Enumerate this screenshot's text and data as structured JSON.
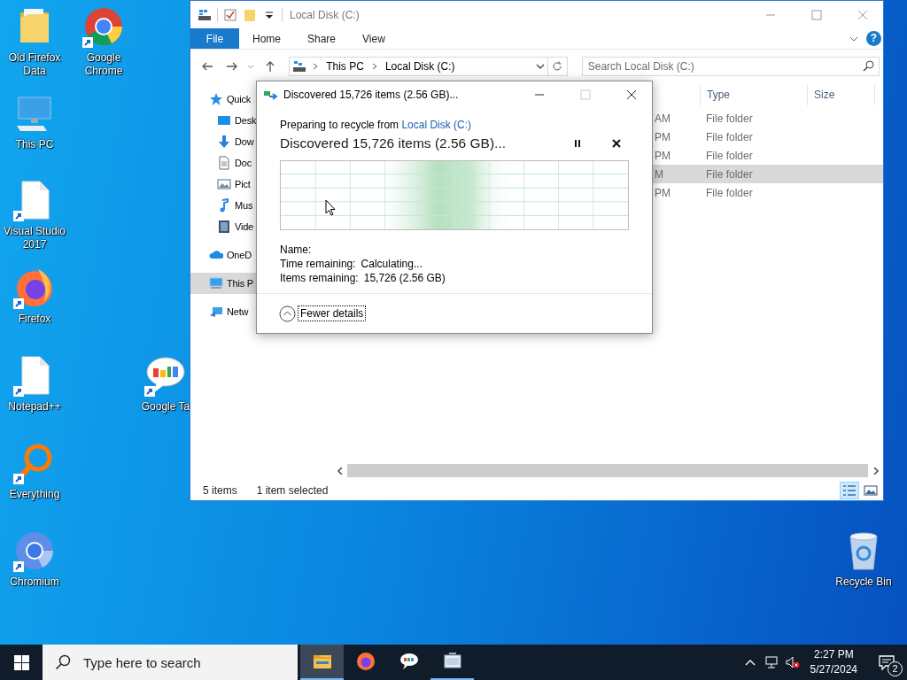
{
  "desktop_icons": [
    {
      "label": "Old Firefox Data",
      "kind": "folder",
      "shortcut": false
    },
    {
      "label": "Google Chrome",
      "kind": "chrome",
      "shortcut": true
    },
    {
      "label": "This PC",
      "kind": "pc",
      "shortcut": false
    },
    {
      "label": "Visual Studio 2017",
      "kind": "file",
      "shortcut": true
    },
    {
      "label": "Firefox",
      "kind": "firefox",
      "shortcut": true
    },
    {
      "label": "Notepad++",
      "kind": "file",
      "shortcut": true
    },
    {
      "label": "Google Ta",
      "kind": "talk",
      "shortcut": true
    },
    {
      "label": "Everything",
      "kind": "everything",
      "shortcut": true
    },
    {
      "label": "Chromium",
      "kind": "chromium",
      "shortcut": true
    },
    {
      "label": "Recycle Bin",
      "kind": "recycle",
      "shortcut": false
    }
  ],
  "explorer": {
    "title": "Local Disk (C:)",
    "file_tab": "File",
    "ribbon_tabs": [
      "Home",
      "Share",
      "View"
    ],
    "help": "?",
    "breadcrumb": [
      "This PC",
      "Local Disk (C:)"
    ],
    "search": {
      "placeholder": "Search Local Disk (C:)"
    },
    "nav_items": [
      {
        "label": "Quick",
        "kind": "star",
        "sub": false,
        "selected": false
      },
      {
        "label": "Desk",
        "kind": "desktop",
        "sub": true,
        "selected": false
      },
      {
        "label": "Dow",
        "kind": "download",
        "sub": true,
        "selected": false
      },
      {
        "label": "Doc",
        "kind": "document",
        "sub": true,
        "selected": false
      },
      {
        "label": "Pict",
        "kind": "pictures",
        "sub": true,
        "selected": false
      },
      {
        "label": "Mus",
        "kind": "music",
        "sub": true,
        "selected": false
      },
      {
        "label": "Vide",
        "kind": "video",
        "sub": true,
        "selected": false
      },
      {
        "label": "OneD",
        "kind": "cloud",
        "sub": false,
        "selected": false
      },
      {
        "label": "This P",
        "kind": "pc",
        "sub": false,
        "selected": true
      },
      {
        "label": "Netw",
        "kind": "network",
        "sub": false,
        "selected": false
      }
    ],
    "columns": [
      "Type",
      "Size"
    ],
    "rows": [
      {
        "date": "AM",
        "type": "File folder",
        "selected": false
      },
      {
        "date": "PM",
        "type": "File folder",
        "selected": false
      },
      {
        "date": "PM",
        "type": "File folder",
        "selected": false
      },
      {
        "date": "M",
        "type": "File folder",
        "selected": true
      },
      {
        "date": "PM",
        "type": "File folder",
        "selected": false
      }
    ],
    "status_bar": {
      "count": "5 items",
      "selection": "1 item selected"
    },
    "views": [
      {
        "kind": "details",
        "selected": true
      },
      {
        "kind": "thumbnails",
        "selected": false
      }
    ]
  },
  "dialog": {
    "title": "Discovered 15,726 items (2.56 GB)...",
    "source": "Preparing to recycle from ",
    "source_link": "Local Disk (C:)",
    "heading": "Discovered 15,726 items (2.56 GB)...",
    "details": [
      {
        "label": "Name:"
      },
      {
        "label": "Time remaining:",
        "value": "Calculating..."
      },
      {
        "label": "Items remaining:",
        "value": "15,726 (2.56 GB)"
      }
    ],
    "toggle": "Fewer details"
  },
  "taskbar": {
    "search": {
      "placeholder": "Type here to search"
    },
    "apps": [
      {
        "kind": "explorer",
        "active": true,
        "running": true
      },
      {
        "kind": "firefox",
        "active": false,
        "running": false
      },
      {
        "kind": "talk",
        "active": false,
        "running": false
      },
      {
        "kind": "recycle-progress",
        "active": false,
        "running": true
      }
    ],
    "time": "2:27 PM",
    "date": "5/27/2024",
    "notifications": "2"
  }
}
